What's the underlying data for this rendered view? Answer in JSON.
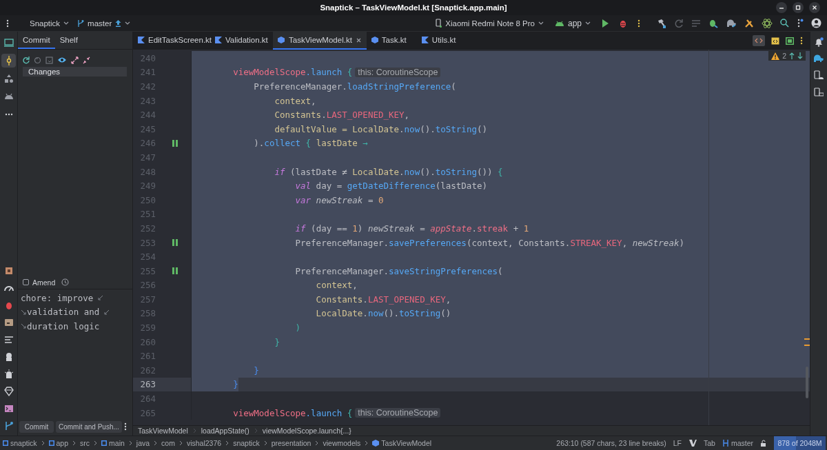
{
  "window": {
    "title": "Snaptick – TaskViewModel.kt [Snaptick.app.main]"
  },
  "toolbar": {
    "project": "Snaptick",
    "branch": "master",
    "device": "Xiaomi Redmi Note 8 Pro",
    "config": "app"
  },
  "tool_strip": [
    {
      "kind": "monitor",
      "selected": false
    },
    {
      "kind": "commit",
      "selected": true
    },
    {
      "kind": "shapes",
      "selected": false
    },
    {
      "kind": "android",
      "selected": false
    },
    {
      "kind": "more",
      "selected": false
    }
  ],
  "commit_panel": {
    "tabs": [
      {
        "label": "Commit",
        "selected": true
      },
      {
        "label": "Shelf",
        "selected": false
      }
    ],
    "changes": "Changes",
    "amend": {
      "label": "Amend",
      "checked": false
    },
    "message_lines": [
      "chore: improve",
      "validation and",
      "duration logic"
    ],
    "buttons": [
      "Commit",
      "Commit and Push..."
    ]
  },
  "tabs": [
    {
      "label": "EditTaskScreen.kt",
      "kind": "kotlin",
      "selected": false
    },
    {
      "label": "Validation.kt",
      "kind": "kotlin",
      "selected": false
    },
    {
      "label": "TaskViewModel.kt",
      "kind": "class",
      "selected": true
    },
    {
      "label": "Task.kt",
      "kind": "class",
      "selected": false
    },
    {
      "label": "Utils.kt",
      "kind": "kotlin",
      "selected": false
    }
  ],
  "inspections": {
    "warnings": "2"
  },
  "code_lines": [
    {
      "number": "240",
      "selected": true,
      "current": false,
      "marker": false
    },
    {
      "number": "241",
      "selected": true,
      "current": false,
      "marker": false,
      "tokens": [
        {
          "kind": "scope",
          "text": "        viewModelScope"
        },
        {
          "kind": "fn",
          "text": ".launch"
        },
        {
          "kind": "brace",
          "text": " {"
        },
        {
          "kind": "hint",
          "text": "this: CoroutineScope"
        }
      ]
    },
    {
      "number": "242",
      "selected": true,
      "current": false,
      "marker": false,
      "tokens": [
        {
          "kind": "plain",
          "text": "            PreferenceManager."
        },
        {
          "kind": "fn",
          "text": "loadStringPreference"
        },
        {
          "kind": "plain",
          "text": "("
        }
      ]
    },
    {
      "number": "243",
      "selected": true,
      "current": false,
      "marker": false,
      "tokens": [
        {
          "kind": "name",
          "text": "                context"
        },
        {
          "kind": "plain",
          "text": ","
        }
      ]
    },
    {
      "number": "244",
      "selected": true,
      "current": false,
      "marker": false,
      "tokens": [
        {
          "kind": "name",
          "text": "                Constants"
        },
        {
          "kind": "plain",
          "text": "."
        },
        {
          "kind": "const",
          "text": "LAST_OPENED_KEY"
        },
        {
          "kind": "plain",
          "text": ","
        }
      ]
    },
    {
      "number": "245",
      "selected": true,
      "current": false,
      "marker": false,
      "tokens": [
        {
          "kind": "name",
          "text": "                defaultValue ="
        },
        {
          "kind": "name",
          "text": " LocalDate"
        },
        {
          "kind": "plain",
          "text": "."
        },
        {
          "kind": "fn",
          "text": "now"
        },
        {
          "kind": "plain",
          "text": "()."
        },
        {
          "kind": "fn",
          "text": "toString"
        },
        {
          "kind": "plain",
          "text": "()"
        }
      ]
    },
    {
      "number": "246",
      "selected": true,
      "current": false,
      "marker": true,
      "tokens": [
        {
          "kind": "plain",
          "text": "            )."
        },
        {
          "kind": "fn",
          "text": "collect"
        },
        {
          "kind": "brace",
          "text": " {"
        },
        {
          "kind": "name",
          "text": " lastDate"
        },
        {
          "kind": "brace",
          "text": " →"
        }
      ]
    },
    {
      "number": "247",
      "selected": true,
      "current": false,
      "marker": false
    },
    {
      "number": "248",
      "selected": true,
      "current": false,
      "marker": false,
      "tokens": [
        {
          "kind": "kw",
          "text": "                if"
        },
        {
          "kind": "plain",
          "text": " (lastDate ≠ "
        },
        {
          "kind": "name",
          "text": "LocalDate"
        },
        {
          "kind": "plain",
          "text": "."
        },
        {
          "kind": "fn",
          "text": "now"
        },
        {
          "kind": "plain",
          "text": "()."
        },
        {
          "kind": "fn",
          "text": "toString"
        },
        {
          "kind": "plain",
          "text": "())"
        },
        {
          "kind": "brace",
          "text": " {"
        }
      ]
    },
    {
      "number": "249",
      "selected": true,
      "current": false,
      "marker": false,
      "tokens": [
        {
          "kind": "kw",
          "text": "                    val"
        },
        {
          "kind": "plain",
          "text": " day = "
        },
        {
          "kind": "fn",
          "text": "getDateDifference"
        },
        {
          "kind": "plain",
          "text": "(lastDate)"
        }
      ]
    },
    {
      "number": "250",
      "selected": true,
      "current": false,
      "marker": false,
      "tokens": [
        {
          "kind": "kw",
          "text": "                    var"
        },
        {
          "kind": "ivar",
          "text": " newStreak"
        },
        {
          "kind": "plain",
          "text": " = "
        },
        {
          "kind": "num",
          "text": "0"
        }
      ]
    },
    {
      "number": "251",
      "selected": true,
      "current": false,
      "marker": false
    },
    {
      "number": "252",
      "selected": true,
      "current": false,
      "marker": false,
      "tokens": [
        {
          "kind": "kw",
          "text": "                    if"
        },
        {
          "kind": "plain",
          "text": " (day == "
        },
        {
          "kind": "num",
          "text": "1"
        },
        {
          "kind": "plain",
          "text": ") "
        },
        {
          "kind": "ivar",
          "text": "newStreak"
        },
        {
          "kind": "plain",
          "text": " = "
        },
        {
          "kind": "iprop",
          "text": "appState"
        },
        {
          "kind": "plain",
          "text": "."
        },
        {
          "kind": "prop",
          "text": "streak"
        },
        {
          "kind": "plain",
          "text": " + "
        },
        {
          "kind": "num",
          "text": "1"
        }
      ]
    },
    {
      "number": "253",
      "selected": true,
      "current": false,
      "marker": true,
      "tokens": [
        {
          "kind": "plain",
          "text": "                    PreferenceManager."
        },
        {
          "kind": "fn",
          "text": "savePreferences"
        },
        {
          "kind": "plain",
          "text": "(context, Constants."
        },
        {
          "kind": "const",
          "text": "STREAK_KEY"
        },
        {
          "kind": "plain",
          "text": ", "
        },
        {
          "kind": "ivar",
          "text": "newStreak"
        },
        {
          "kind": "plain",
          "text": ")"
        }
      ]
    },
    {
      "number": "254",
      "selected": true,
      "current": false,
      "marker": false
    },
    {
      "number": "255",
      "selected": true,
      "current": false,
      "marker": true,
      "tokens": [
        {
          "kind": "plain",
          "text": "                    PreferenceManager."
        },
        {
          "kind": "fn",
          "text": "saveStringPreferences"
        },
        {
          "kind": "plain",
          "text": "("
        }
      ]
    },
    {
      "number": "256",
      "selected": true,
      "current": false,
      "marker": false,
      "tokens": [
        {
          "kind": "name",
          "text": "                        context"
        },
        {
          "kind": "plain",
          "text": ","
        }
      ]
    },
    {
      "number": "257",
      "selected": true,
      "current": false,
      "marker": false,
      "tokens": [
        {
          "kind": "name",
          "text": "                        Constants"
        },
        {
          "kind": "plain",
          "text": "."
        },
        {
          "kind": "const",
          "text": "LAST_OPENED_KEY"
        },
        {
          "kind": "plain",
          "text": ","
        }
      ]
    },
    {
      "number": "258",
      "selected": true,
      "current": false,
      "marker": false,
      "tokens": [
        {
          "kind": "name",
          "text": "                        LocalDate"
        },
        {
          "kind": "plain",
          "text": "."
        },
        {
          "kind": "fn",
          "text": "now"
        },
        {
          "kind": "plain",
          "text": "()."
        },
        {
          "kind": "fn",
          "text": "toString"
        },
        {
          "kind": "plain",
          "text": "()"
        }
      ]
    },
    {
      "number": "259",
      "selected": true,
      "current": false,
      "marker": false,
      "tokens": [
        {
          "kind": "brace",
          "text": "                    )"
        }
      ]
    },
    {
      "number": "260",
      "selected": true,
      "current": false,
      "marker": false,
      "tokens": [
        {
          "kind": "brace",
          "text": "                }"
        }
      ]
    },
    {
      "number": "261",
      "selected": true,
      "current": false,
      "marker": false
    },
    {
      "number": "262",
      "selected": true,
      "current": false,
      "marker": false,
      "tokens": [
        {
          "kind": "bbrace",
          "text": "            }"
        }
      ]
    },
    {
      "number": "263",
      "selected": true,
      "current": true,
      "marker": false,
      "tokens": [
        {
          "kind": "bbrace",
          "text": "        }"
        }
      ]
    },
    {
      "number": "264",
      "selected": false,
      "current": false,
      "marker": false
    },
    {
      "number": "265",
      "selected": false,
      "current": false,
      "marker": false,
      "tokens": [
        {
          "kind": "scope",
          "text": "        viewModelScope"
        },
        {
          "kind": "fn",
          "text": ".launch"
        },
        {
          "kind": "brace",
          "text": " {"
        },
        {
          "kind": "hint",
          "text": "this: CoroutineScope"
        }
      ]
    }
  ],
  "breadcrumbs": [
    "TaskViewModel",
    "loadAppState()",
    "viewModelScope.launch{...}"
  ],
  "status_bar": {
    "path": [
      {
        "label": "snaptick",
        "kind": "module"
      },
      {
        "label": "app",
        "kind": "module"
      },
      {
        "label": "src",
        "kind": "folder"
      },
      {
        "label": "main",
        "kind": "module"
      },
      {
        "label": "java",
        "kind": "folder"
      },
      {
        "label": "com",
        "kind": "folder"
      },
      {
        "label": "vishal2376",
        "kind": "folder"
      },
      {
        "label": "snaptick",
        "kind": "folder"
      },
      {
        "label": "presentation",
        "kind": "folder"
      },
      {
        "label": "viewmodels",
        "kind": "folder"
      },
      {
        "label": "TaskViewModel",
        "kind": "class"
      }
    ],
    "position": "263:10 (587 chars, 23 line breaks)",
    "line_ending": "LF",
    "indent": "Tab",
    "branch": "master",
    "memory": {
      "text": "878 of 2048M",
      "level": 0.43
    }
  }
}
